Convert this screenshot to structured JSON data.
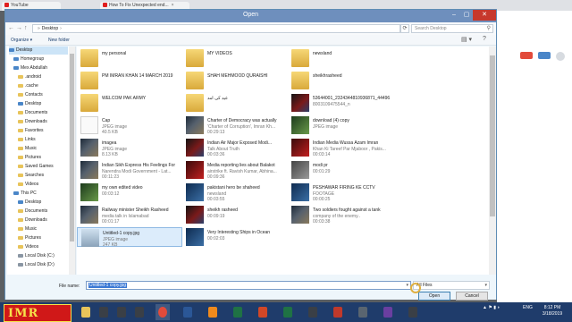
{
  "browser": {
    "tabs": [
      {
        "label": "YouTube"
      },
      {
        "label": "How To Fix Unexpected end..."
      }
    ],
    "new_tab": "+",
    "page_chip_red": "#e24b3b",
    "page_chip_blue": "#4a86c8"
  },
  "dialog": {
    "title": "Open",
    "close": "✕",
    "minimize": "–",
    "maximize": "▢",
    "address": {
      "root_chevron": "»",
      "location": "Desktop",
      "chevron": "›"
    },
    "refresh": "⟳",
    "search_placeholder": "Search Desktop",
    "toolbar": {
      "organize": "Organize ▾",
      "new_folder": "New folder",
      "view": "▤ ▾",
      "help": "?"
    }
  },
  "nav": [
    {
      "label": "Desktop",
      "indent": 0,
      "icon": "blue",
      "selected": true
    },
    {
      "label": "Homegroup",
      "indent": 1,
      "icon": "blue"
    },
    {
      "label": "Mex Abdullah",
      "indent": 1,
      "icon": "blue"
    },
    {
      "label": ".android",
      "indent": 2,
      "icon": "folder"
    },
    {
      "label": ".cache",
      "indent": 2,
      "icon": "folder"
    },
    {
      "label": "Contacts",
      "indent": 2,
      "icon": "folder"
    },
    {
      "label": "Desktop",
      "indent": 2,
      "icon": "blue"
    },
    {
      "label": "Documents",
      "indent": 2,
      "icon": "folder"
    },
    {
      "label": "Downloads",
      "indent": 2,
      "icon": "folder"
    },
    {
      "label": "Favorites",
      "indent": 2,
      "icon": "folder"
    },
    {
      "label": "Links",
      "indent": 2,
      "icon": "folder"
    },
    {
      "label": "Music",
      "indent": 2,
      "icon": "folder"
    },
    {
      "label": "Pictures",
      "indent": 2,
      "icon": "folder"
    },
    {
      "label": "Saved Games",
      "indent": 2,
      "icon": "folder"
    },
    {
      "label": "Searches",
      "indent": 2,
      "icon": "folder"
    },
    {
      "label": "Videos",
      "indent": 2,
      "icon": "folder"
    },
    {
      "label": "This PC",
      "indent": 1,
      "icon": "blue"
    },
    {
      "label": "Desktop",
      "indent": 2,
      "icon": "blue"
    },
    {
      "label": "Documents",
      "indent": 2,
      "icon": "folder"
    },
    {
      "label": "Downloads",
      "indent": 2,
      "icon": "folder"
    },
    {
      "label": "Music",
      "indent": 2,
      "icon": "folder"
    },
    {
      "label": "Pictures",
      "indent": 2,
      "icon": "folder"
    },
    {
      "label": "Videos",
      "indent": 2,
      "icon": "folder"
    },
    {
      "label": "Local Disk (C:)",
      "indent": 2,
      "icon": "drive"
    },
    {
      "label": "Local Disk (D:)",
      "indent": 2,
      "icon": "drive"
    }
  ],
  "files": [
    {
      "name": "my personal",
      "sub": "",
      "sub2": "",
      "thumb": "folder"
    },
    {
      "name": "MY VIDEOS",
      "sub": "",
      "sub2": "",
      "thumb": "folder"
    },
    {
      "name": "newsland",
      "sub": "",
      "sub2": "",
      "thumb": "folder"
    },
    {
      "name": "PM IMRAN KHAN 14 MARCH 2019",
      "sub": "",
      "sub2": "",
      "thumb": "folder"
    },
    {
      "name": "SHAH MEHMOOD QURAISHI",
      "sub": "",
      "sub2": "",
      "thumb": "folder"
    },
    {
      "name": "sheikhrasheed",
      "sub": "",
      "sub2": "",
      "thumb": "folder"
    },
    {
      "name": "WELCOM PAK ARMY",
      "sub": "",
      "sub2": "",
      "thumb": "folder"
    },
    {
      "name": "عید کی آمد",
      "sub": "",
      "sub2": "",
      "thumb": "folder"
    },
    {
      "name": "53644001_2324344810936871_44496",
      "sub": "8003109475544_n",
      "sub2": "",
      "thumb": "news"
    },
    {
      "name": "Cap",
      "sub": "JPEG image",
      "sub2": "40.5 KB",
      "thumb": "paper"
    },
    {
      "name": "Charter of Democracy was actually",
      "sub": "'Charter of Corruption', Imran Kh...",
      "sub2": "00:29:13",
      "thumb": "dark"
    },
    {
      "name": "download (4) copy",
      "sub": "JPEG image",
      "sub2": "",
      "thumb": "green"
    },
    {
      "name": "imagea",
      "sub": "JPEG image",
      "sub2": "8.13 KB",
      "thumb": "dark"
    },
    {
      "name": "Indian Air Major Exposed Modi...",
      "sub": "Talk About Truth",
      "sub2": "00:03:36",
      "thumb": "news"
    },
    {
      "name": "Indian Media Wussa Azam Imran",
      "sub": "Khan Ki Tareef Par Mjaboor , Pakis...",
      "sub2": "00:03:14",
      "thumb": "red"
    },
    {
      "name": "Indian Sikh Express His Feelings For",
      "sub": "Narendra Modi Government - Lat...",
      "sub2": "00:11:23",
      "thumb": "dark"
    },
    {
      "name": "Media reporting lies about Balakot",
      "sub": "airstrike ft. Ravish Kumar, Abhina...",
      "sub2": "00:09:36",
      "thumb": "red"
    },
    {
      "name": "modi pr",
      "sub": "00:01:29",
      "sub2": "",
      "thumb": "gray"
    },
    {
      "name": "my own edited video",
      "sub": "00:03:12",
      "sub2": "",
      "thumb": "green"
    },
    {
      "name": "pakistani hero be shaheed",
      "sub": "newsland",
      "sub2": "00:03:55",
      "thumb": "blue"
    },
    {
      "name": "PESHAWAR FIRING KE CCTV",
      "sub": "FOOTAGE",
      "sub2": "00:00:25",
      "thumb": "blue"
    },
    {
      "name": "Railway minister Sheikh Rasheed",
      "sub": "media talk in Islamabad",
      "sub2": "00:01:17",
      "thumb": "dark"
    },
    {
      "name": "sheikh rasheed",
      "sub": "00:09:19",
      "sub2": "",
      "thumb": "news"
    },
    {
      "name": "Two soldiers fought against a tank",
      "sub": "company of the enemy..",
      "sub2": "00:03:38",
      "thumb": "dark"
    },
    {
      "name": "Untitled-1 copy.jpg",
      "sub": "JPEG image",
      "sub2": "247 KB",
      "thumb": "sky",
      "selected": true
    },
    {
      "name": "Very Interesting Ships in Ocean",
      "sub": "00:02:03",
      "sub2": "",
      "thumb": "blue"
    }
  ],
  "bottom": {
    "filename_label": "File name:",
    "filename_value": "Untitled-1 copy.jpg",
    "dropdown": "▾",
    "filter": "All Files",
    "open": "Open",
    "cancel": "Cancel"
  },
  "taskbar": {
    "logo_text": "IMR",
    "tray_lang": "ENG",
    "time": "8:12 PM",
    "date": "3/18/2019",
    "tray_icons": "▲ ⚑ ▮ ◗"
  }
}
